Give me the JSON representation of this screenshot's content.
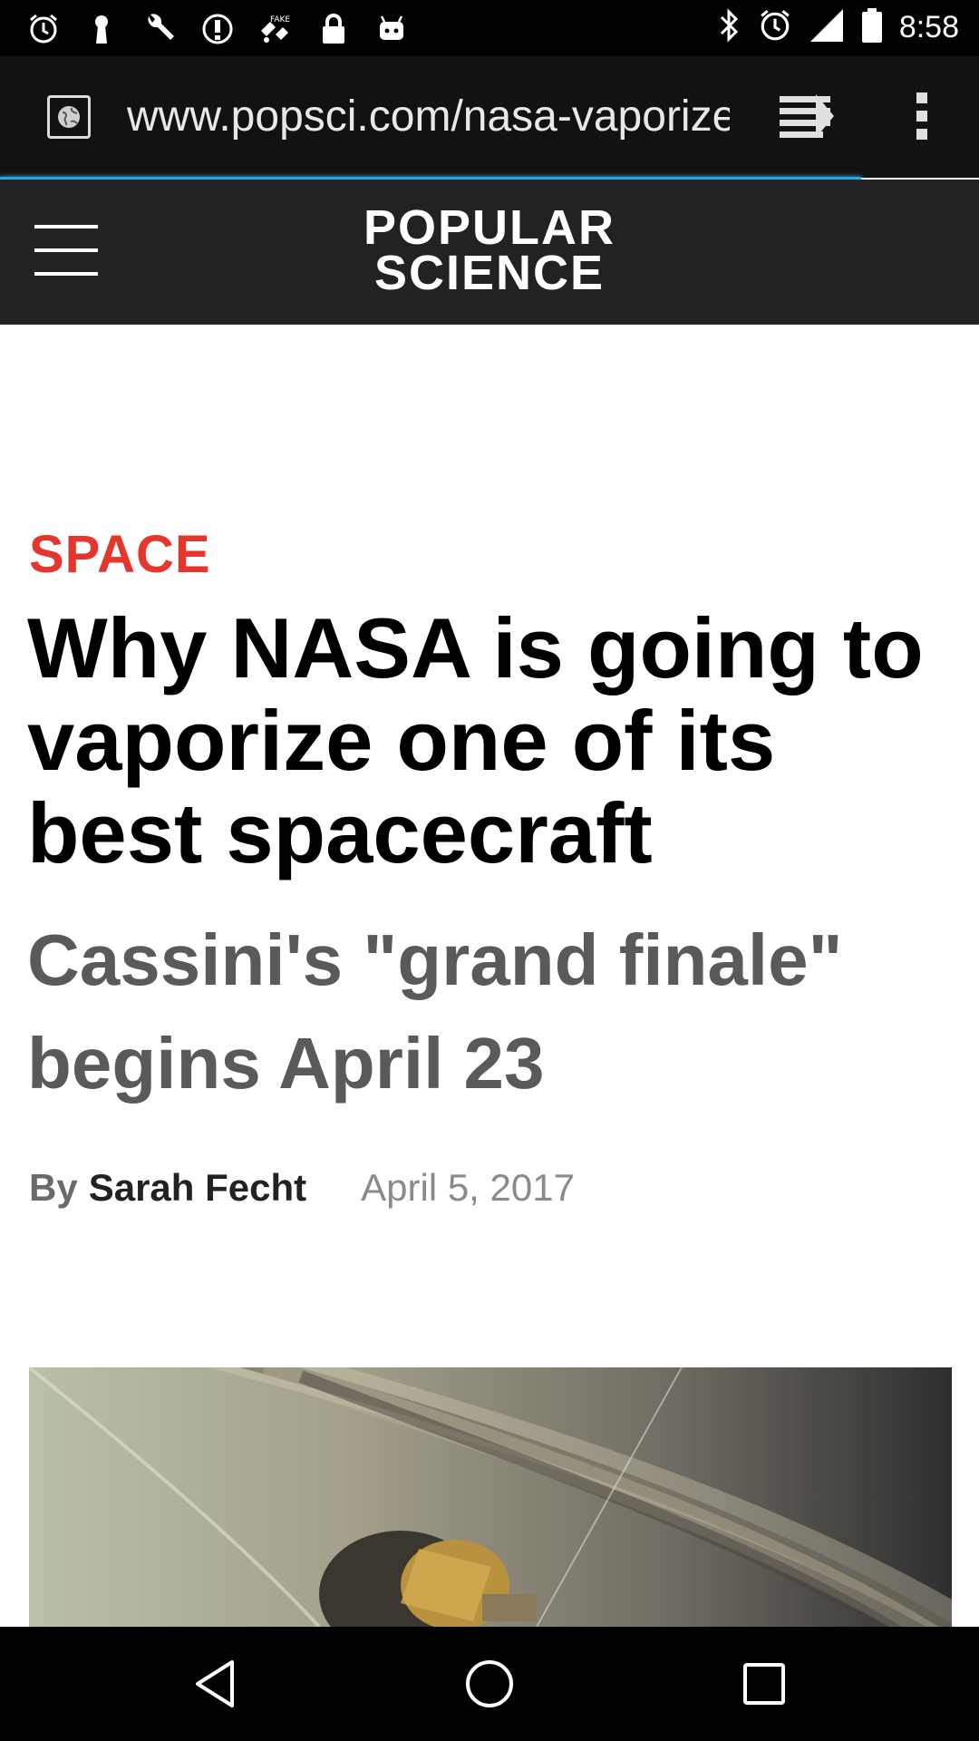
{
  "status_bar": {
    "time": "8:58",
    "left_icons": [
      "alarm-icon",
      "keyhole-icon",
      "wrench-icon",
      "info-circle-icon",
      "fake-gps-icon",
      "lock-icon",
      "android-icon"
    ],
    "right_icons": [
      "bluetooth-icon",
      "alarm-icon",
      "signal-icon",
      "battery-icon"
    ]
  },
  "browser": {
    "url": "www.popsci.com/nasa-vaporize",
    "site_icon": "globe-page-icon",
    "reader_icon": "reader-mode-icon",
    "menu_icon": "overflow-menu-icon",
    "accent_color": "#2aa7e0"
  },
  "site": {
    "logo_line1": "POPULAR",
    "logo_line2": "SCIENCE",
    "menu_icon": "hamburger-icon",
    "header_color": "#202224"
  },
  "article": {
    "category": "SPACE",
    "category_color": "#e4362d",
    "headline": "Why NASA is going to vaporize one of its best spacecraft",
    "subhead": "Cassini's \"grand finale\" begins April 23",
    "by_label": "By",
    "author": "Sarah Fecht",
    "date": "April 5, 2017"
  },
  "navbar": {
    "back_icon": "back-triangle-icon",
    "home_icon": "home-circle-icon",
    "recents_icon": "recents-square-icon"
  }
}
